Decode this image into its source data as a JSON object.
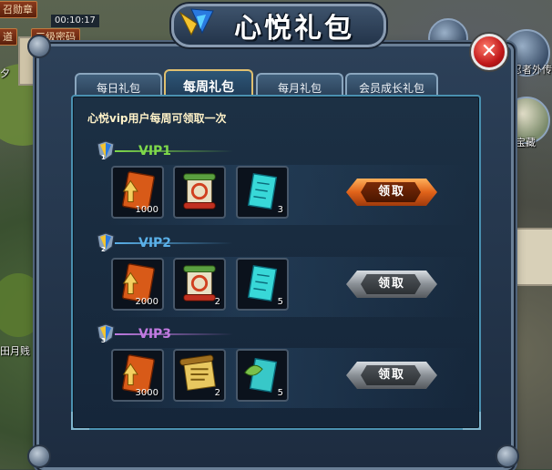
{
  "background": {
    "top_buttons": [
      "召勋章",
      "道",
      "三级密码"
    ],
    "clock": "00:10:17",
    "left_labels": [
      "夕",
      "田月贱"
    ],
    "right_labels": [
      "忍者外传",
      "宝藏"
    ]
  },
  "window": {
    "title": "心悦礼包",
    "close_symbol": "✕"
  },
  "tabs": [
    {
      "label": "每日礼包",
      "active": false
    },
    {
      "label": "每周礼包",
      "active": true
    },
    {
      "label": "每月礼包",
      "active": false
    },
    {
      "label": "会员成长礼包",
      "active": false
    }
  ],
  "subtitle": "心悦vip用户每周可领取一次",
  "rows": [
    {
      "vip": "VIP1",
      "tier": "1",
      "vip_color": "#7ed84a",
      "items": [
        {
          "icon": "orange-card-arrow-icon",
          "qty": "1000"
        },
        {
          "icon": "scroll-icon",
          "qty": ""
        },
        {
          "icon": "cyan-scroll-icon",
          "qty": "3"
        }
      ],
      "button": "领取",
      "enabled": true
    },
    {
      "vip": "VIP2",
      "tier": "2",
      "vip_color": "#5ab0e8",
      "items": [
        {
          "icon": "orange-card-arrow-icon",
          "qty": "2000"
        },
        {
          "icon": "scroll-icon",
          "qty": "2"
        },
        {
          "icon": "cyan-scroll-icon",
          "qty": "5"
        }
      ],
      "button": "领取",
      "enabled": false
    },
    {
      "vip": "VIP3",
      "tier": "3",
      "vip_color": "#c07ae0",
      "items": [
        {
          "icon": "orange-card-arrow-icon",
          "qty": "3000"
        },
        {
          "icon": "gold-scroll-icon",
          "qty": "2"
        },
        {
          "icon": "leaf-cyan-scroll-icon",
          "qty": "5"
        }
      ],
      "button": "领取",
      "enabled": false
    }
  ]
}
